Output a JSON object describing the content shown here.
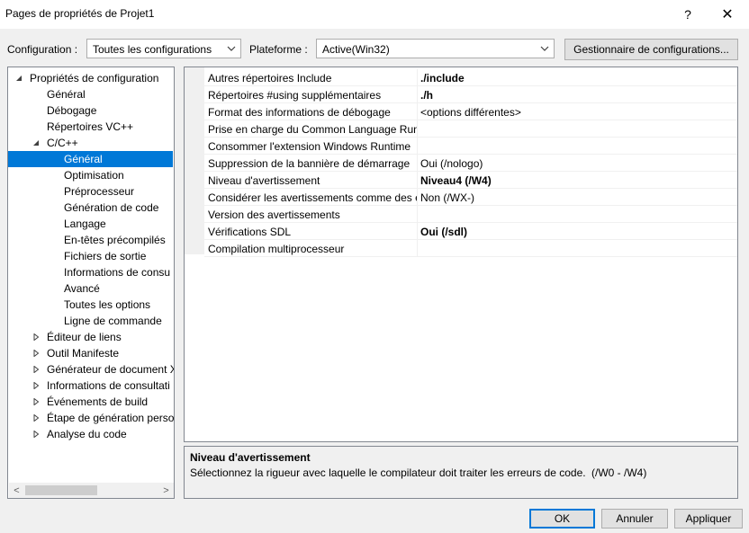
{
  "window": {
    "title": "Pages de propriétés de Projet1",
    "help_glyph": "?",
    "close_glyph": "✕"
  },
  "toolbar": {
    "configuration_label": "Configuration :",
    "configuration_value": "Toutes les configurations",
    "platform_label": "Plateforme :",
    "platform_value": "Active(Win32)",
    "config_manager_label": "Gestionnaire de configurations..."
  },
  "tree": {
    "items": [
      {
        "label": "Propriétés de configuration",
        "expander": "expanded"
      },
      {
        "label": "Général",
        "expander": "none"
      },
      {
        "label": "Débogage",
        "expander": "none"
      },
      {
        "label": "Répertoires VC++",
        "expander": "none"
      },
      {
        "label": "C/C++",
        "expander": "expanded"
      },
      {
        "label": "Général",
        "expander": "none",
        "selected": true
      },
      {
        "label": "Optimisation",
        "expander": "none"
      },
      {
        "label": "Préprocesseur",
        "expander": "none"
      },
      {
        "label": "Génération de code",
        "expander": "none"
      },
      {
        "label": "Langage",
        "expander": "none"
      },
      {
        "label": "En-têtes précompilés",
        "expander": "none"
      },
      {
        "label": "Fichiers de sortie",
        "expander": "none"
      },
      {
        "label": "Informations de consu",
        "expander": "none"
      },
      {
        "label": "Avancé",
        "expander": "none"
      },
      {
        "label": "Toutes les options",
        "expander": "none"
      },
      {
        "label": "Ligne de commande",
        "expander": "none"
      },
      {
        "label": "Éditeur de liens",
        "expander": "collapsed"
      },
      {
        "label": "Outil Manifeste",
        "expander": "collapsed"
      },
      {
        "label": "Générateur de document X",
        "expander": "collapsed"
      },
      {
        "label": "Informations de consultati",
        "expander": "collapsed"
      },
      {
        "label": "Événements de build",
        "expander": "collapsed"
      },
      {
        "label": "Étape de génération perso",
        "expander": "collapsed"
      },
      {
        "label": "Analyse du code",
        "expander": "collapsed"
      }
    ],
    "scroll_left": "<",
    "scroll_right": ">"
  },
  "properties": [
    {
      "name": "Autres répertoires Include",
      "value": "./include",
      "bold": true
    },
    {
      "name": "Répertoires #using supplémentaires",
      "value": "./h",
      "bold": true
    },
    {
      "name": "Format des informations de débogage",
      "value": "<options différentes>",
      "bold": false
    },
    {
      "name": "Prise en charge du Common Language Runt",
      "value": "",
      "bold": false
    },
    {
      "name": "Consommer l'extension Windows Runtime",
      "value": "",
      "bold": false
    },
    {
      "name": "Suppression de la bannière de démarrage",
      "value": "Oui (/nologo)",
      "bold": false
    },
    {
      "name": "Niveau d'avertissement",
      "value": "Niveau4 (/W4)",
      "bold": true
    },
    {
      "name": "Considérer les avertissements comme des er",
      "value": "Non (/WX-)",
      "bold": false
    },
    {
      "name": "Version des avertissements",
      "value": "",
      "bold": false
    },
    {
      "name": "Vérifications SDL",
      "value": "Oui (/sdl)",
      "bold": true
    },
    {
      "name": "Compilation multiprocesseur",
      "value": "",
      "bold": false
    }
  ],
  "description": {
    "title": "Niveau d'avertissement",
    "text": "Sélectionnez la rigueur avec laquelle le compilateur doit traiter les erreurs de code.",
    "range": "(/W0 - /W4)"
  },
  "buttons": {
    "ok": "OK",
    "cancel": "Annuler",
    "apply": "Appliquer"
  },
  "colors": {
    "selection": "#0078d7",
    "window_bg": "#f0f0f0",
    "default_button_border": "#0078d7"
  }
}
